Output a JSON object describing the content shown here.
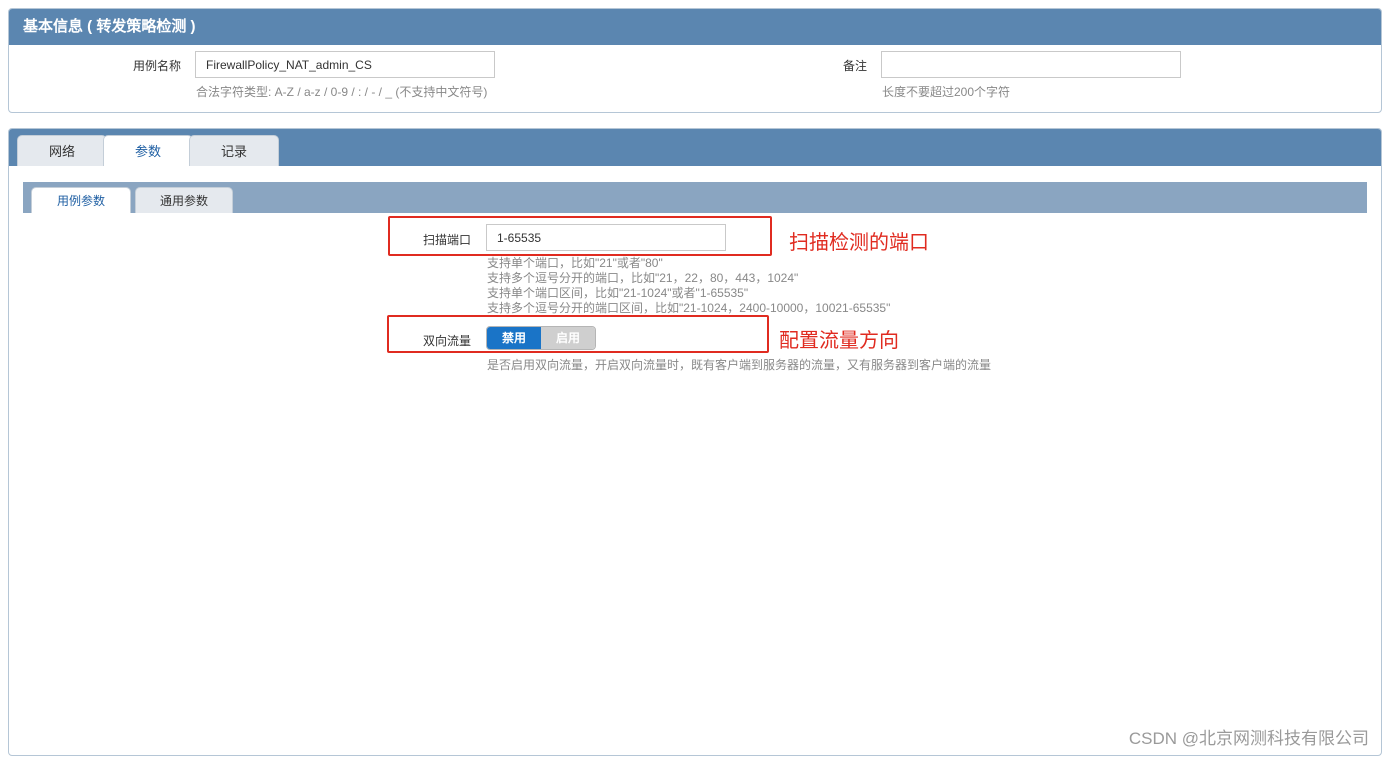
{
  "basic": {
    "title": "基本信息 ( 转发策略检测 )",
    "case_name_label": "用例名称",
    "case_name_value": "FirewallPolicy_NAT_admin_CS",
    "case_name_hint": "合法字符类型: A-Z / a-z / 0-9 / : / - / _ (不支持中文符号)",
    "remark_label": "备注",
    "remark_value": "",
    "remark_hint": "长度不要超过200个字符"
  },
  "main_tabs": [
    {
      "label": "网络",
      "active": false
    },
    {
      "label": "参数",
      "active": true
    },
    {
      "label": "记录",
      "active": false
    }
  ],
  "sub_tabs": [
    {
      "label": "用例参数",
      "active": true
    },
    {
      "label": "通用参数",
      "active": false
    }
  ],
  "params": {
    "scan_port_label": "扫描端口",
    "scan_port_value": "1-65535",
    "scan_port_hints": [
      "支持单个端口，比如\"21\"或者\"80\"",
      "支持多个逗号分开的端口，比如\"21，22，80，443，1024\"",
      "支持单个端口区间，比如\"21-1024\"或者\"1-65535\"",
      "支持多个逗号分开的端口区间，比如\"21-1024，2400-10000，10021-65535\""
    ],
    "bidirectional_label": "双向流量",
    "toggle_disable": "禁用",
    "toggle_enable": "启用",
    "bidirectional_hint": "是否启用双向流量，开启双向流量时，既有客户端到服务器的流量，又有服务器到客户端的流量"
  },
  "annotations": {
    "scan_port_note": "扫描检测的端口",
    "direction_note": "配置流量方向"
  },
  "watermark": "CSDN @北京网测科技有限公司",
  "colors": {
    "header_blue": "#5b86b0",
    "subtab_bar": "#8aa5c1",
    "annotation_red": "#e02b20",
    "toggle_active": "#1a74c7"
  }
}
